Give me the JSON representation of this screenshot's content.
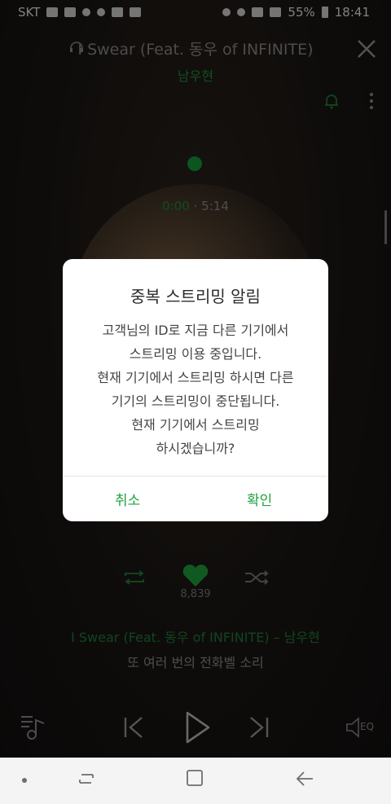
{
  "status_bar": {
    "carrier": "SKT",
    "battery": "55%",
    "time": "18:41"
  },
  "header": {
    "title": "I Swear (Feat. 동우 of INFINITE)",
    "artist": "남우현"
  },
  "player": {
    "time_elapsed": "0:00",
    "time_separator": "·",
    "time_total": "5:14",
    "like_count": "8,839",
    "now_playing_line": "I Swear (Feat. 동우 of INFINITE) – 남우현",
    "lyric_line": "또 여러 번의 전화벨 소리",
    "eq_label": "EQ"
  },
  "dialog": {
    "title": "중복 스트리밍 알림",
    "message_lines": [
      "고객님의 ID로 지금 다른 기기에서",
      "스트리밍 이용 중입니다.",
      "현재 기기에서 스트리밍 하시면 다른",
      "기기의 스트리밍이 중단됩니다.",
      "현재 기기에서 스트리밍",
      "하시겠습니까?"
    ],
    "cancel_label": "취소",
    "confirm_label": "확인"
  },
  "colors": {
    "accent_green": "#1fa33f",
    "dark_green": "#1e7e36"
  }
}
